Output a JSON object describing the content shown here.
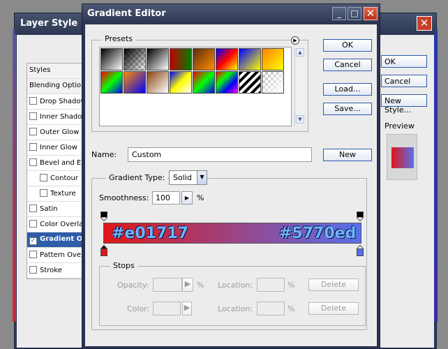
{
  "background_window": {
    "title": "Layer Style",
    "close_glyph": "✕",
    "sidebar": [
      {
        "label": "Styles",
        "type": "header"
      },
      {
        "label": "Blending Options: Default",
        "type": "header"
      },
      {
        "label": "Drop Shadow",
        "checked": false
      },
      {
        "label": "Inner Shadow",
        "checked": false
      },
      {
        "label": "Outer Glow",
        "checked": false
      },
      {
        "label": "Inner Glow",
        "checked": false
      },
      {
        "label": "Bevel and Emboss",
        "checked": false
      },
      {
        "label": "Contour",
        "checked": false,
        "indent": true
      },
      {
        "label": "Texture",
        "checked": false,
        "indent": true
      },
      {
        "label": "Satin",
        "checked": false
      },
      {
        "label": "Color Overlay",
        "checked": false
      },
      {
        "label": "Gradient Overlay",
        "checked": true,
        "selected": true
      },
      {
        "label": "Pattern Overlay",
        "checked": false
      },
      {
        "label": "Stroke",
        "checked": false
      }
    ],
    "buttons": {
      "ok": "OK",
      "cancel": "Cancel",
      "new_style": "New Style..."
    },
    "preview_label": "Preview",
    "check_glyph": "✓"
  },
  "dialog": {
    "title": "Gradient Editor",
    "titlebar_buttons": {
      "minimize": "_",
      "maximize": "□",
      "close": "✕"
    },
    "presets_label": "Presets",
    "presets_menu_glyph": "▶",
    "presets": [
      [
        "#000000",
        "#ffffff"
      ],
      [
        "#000000",
        "transparent"
      ],
      [
        "#000000",
        "#ffffff"
      ],
      [
        "#c00000",
        "#008000"
      ],
      [
        "#5a2e0e",
        "#ff8c00"
      ],
      [
        "#0000ff",
        "#ff0000",
        "#ffff00"
      ],
      [
        "#0000ff",
        "#ffff00"
      ],
      [
        "#ff8000",
        "#ffff00"
      ],
      [
        "#ff0000",
        "#00ff00",
        "#0000ff"
      ],
      [
        "#ff8c00",
        "#0000ff"
      ],
      [
        "#8b4513",
        "#ffffff"
      ],
      [
        "#0000ff",
        "#ffff00",
        "#ffffff"
      ],
      [
        "#ff0000",
        "#00ff00",
        "#0000ff"
      ],
      [
        "#ff0000",
        "#00ff00",
        "#0000ff",
        "#ff00ff"
      ],
      [
        "#000000",
        "#ffffff"
      ],
      [
        "transparent",
        "#ffffff"
      ]
    ],
    "scroll_up_glyph": "▲",
    "scroll_down_glyph": "▼",
    "buttons": {
      "ok": "OK",
      "cancel": "Cancel",
      "load": "Load...",
      "save": "Save...",
      "new": "New"
    },
    "name_label": "Name:",
    "name_value": "Custom",
    "gradient_type_label": "Gradient Type:",
    "gradient_type_value": "Solid",
    "select_arrow_glyph": "▼",
    "smoothness_label": "Smoothness:",
    "smoothness_value": "100",
    "smoothness_arrow_glyph": "▶",
    "percent": "%",
    "gradient": {
      "start_color": "#e01717",
      "end_color": "#5770ed",
      "start_label": "#e01717",
      "end_label": "#5770ed"
    },
    "stops": {
      "label": "Stops",
      "opacity_label": "Opacity:",
      "color_label": "Color:",
      "location_label": "Location:",
      "percent": "%",
      "delete_label": "Delete"
    }
  }
}
